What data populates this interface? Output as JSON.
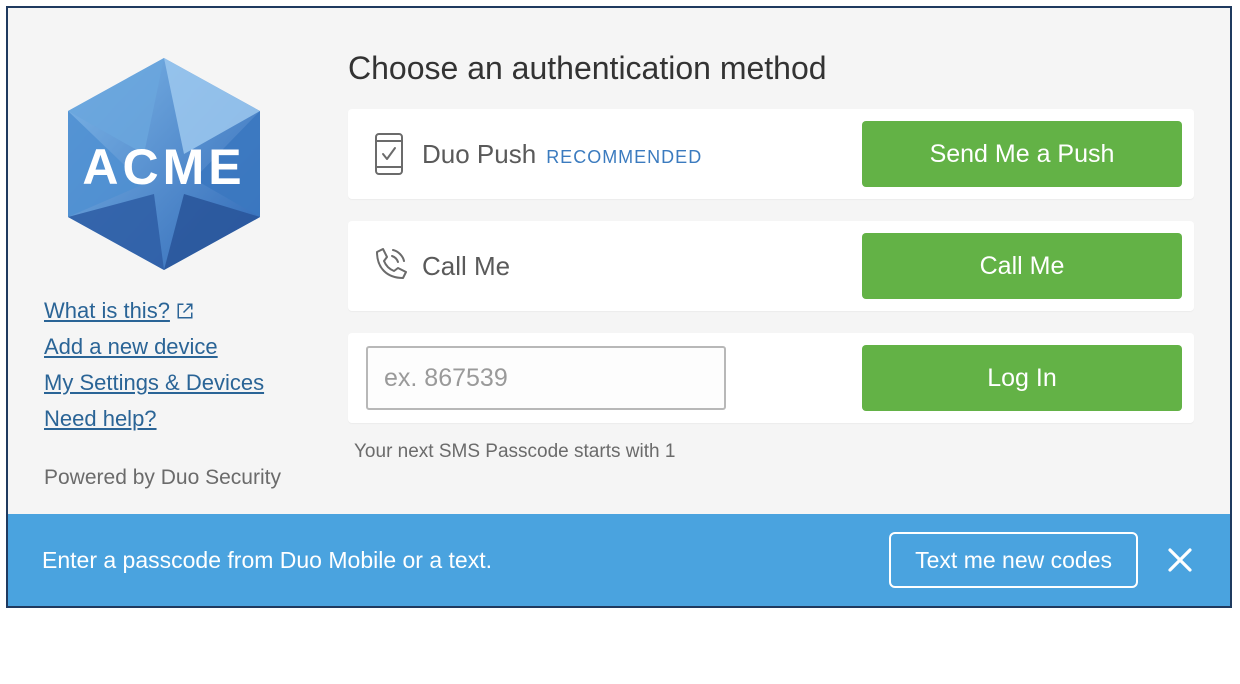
{
  "sidebar": {
    "logo_text": "ACME",
    "links": {
      "what_is_this": "What is this?",
      "add_device": "Add a new device",
      "my_settings": "My Settings & Devices",
      "need_help": "Need help?"
    },
    "powered_by": "Powered by Duo Security"
  },
  "main": {
    "heading": "Choose an authentication method",
    "methods": {
      "push": {
        "label": "Duo Push",
        "badge": "RECOMMENDED",
        "button": "Send Me a Push"
      },
      "call": {
        "label": "Call Me",
        "button": "Call Me"
      },
      "passcode": {
        "placeholder": "ex. 867539",
        "button": "Log In"
      }
    },
    "hint": "Your next SMS Passcode starts with 1"
  },
  "footer": {
    "message": "Enter a passcode from Duo Mobile or a text.",
    "button": "Text me new codes"
  },
  "colors": {
    "accent_green": "#63b246",
    "bar_blue": "#4aa3df",
    "link_blue": "#2a6496"
  }
}
